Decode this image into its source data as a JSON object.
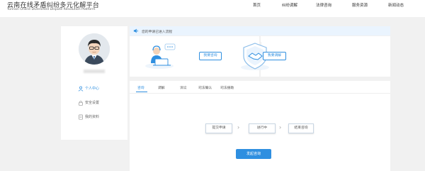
{
  "header": {
    "title_cn": "云南在线矛盾纠纷多元化解平台",
    "title_en": "Yunnan Online Diversified Dispute Resolution Platform",
    "nav": [
      "首页",
      "纠纷调解",
      "法律咨询",
      "服务资源",
      "新闻动态"
    ]
  },
  "sidebar": {
    "items": [
      {
        "label": "个人中心",
        "icon": "user-icon",
        "active": true
      },
      {
        "label": "安全设置",
        "icon": "lock-icon",
        "active": false
      },
      {
        "label": "我的资料",
        "icon": "document-icon",
        "active": false
      }
    ]
  },
  "notice": {
    "text": "您的申请已进入流程"
  },
  "services": [
    {
      "button": "我要咨询",
      "icon": "consultation-illustration"
    },
    {
      "button": "我要调解",
      "icon": "handshake-shield-illustration"
    }
  ],
  "tabs": [
    "咨询",
    "调解",
    "诉讼",
    "司法确认",
    "司法援助"
  ],
  "steps": [
    "提交申请",
    "进行中",
    "结束咨询"
  ],
  "primary_button": "发起咨询",
  "colors": {
    "accent": "#2f8fe0",
    "background": "#f1f1f1",
    "notice_bg": "#eaf4fe"
  }
}
